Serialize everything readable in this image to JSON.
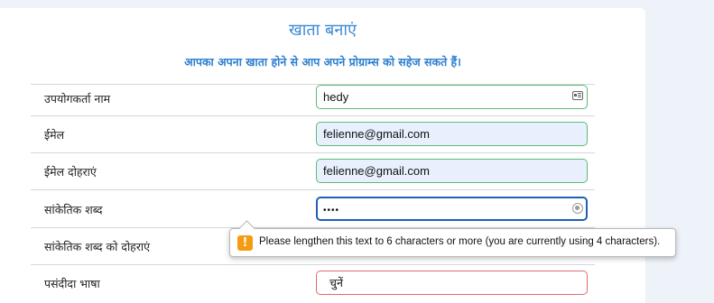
{
  "form": {
    "title": "खाता बनाएं",
    "subtitle": "आपका अपना खाता होने से आप अपने प्रोग्राम्स को सहेज सकते हैं।",
    "fields": [
      {
        "label": "उपयोगकर्ता नाम",
        "value": "hedy"
      },
      {
        "label": "ईमेल",
        "value": "felienne@gmail.com"
      },
      {
        "label": "ईमेल दोहराएं",
        "value": "felienne@gmail.com"
      },
      {
        "label": "सांकेतिक शब्द",
        "value": "••••"
      },
      {
        "label": "सांकेतिक शब्द को दोहराएं",
        "value": ""
      },
      {
        "label": "पसंदीदा भाषा",
        "value": "चुनें"
      }
    ]
  },
  "validation": {
    "message": "Please lengthen this text to 6 characters or more (you are currently using 4 characters).",
    "icon": "!"
  },
  "colors": {
    "accent": "#3d8ad6",
    "valid_border": "#5cbb74",
    "focus_border": "#1f5fb4",
    "invalid_border": "#e06b6b",
    "warning": "#f39c12"
  }
}
